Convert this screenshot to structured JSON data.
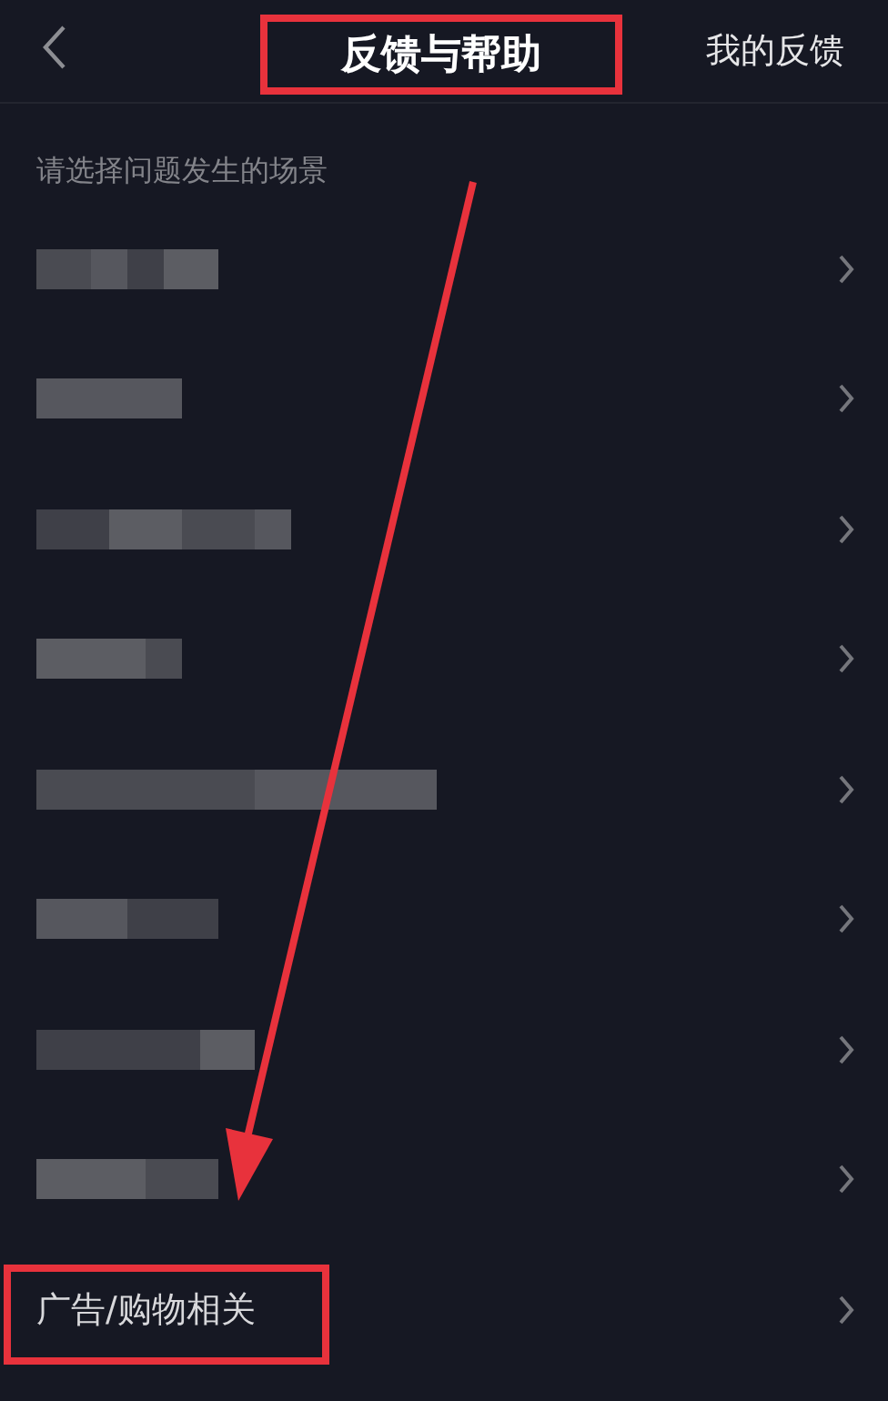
{
  "header": {
    "title": "反馈与帮助",
    "title_highlighted": true,
    "action": "我的反馈"
  },
  "prompt": "请选择问题发生的场景",
  "items": [
    {
      "kind": "redacted"
    },
    {
      "kind": "redacted"
    },
    {
      "kind": "redacted"
    },
    {
      "kind": "redacted"
    },
    {
      "kind": "redacted"
    },
    {
      "kind": "redacted"
    },
    {
      "kind": "redacted"
    },
    {
      "kind": "redacted"
    },
    {
      "kind": "text",
      "label": "广告/购物相关",
      "highlighted": true
    }
  ],
  "annotation": {
    "kind": "arrow"
  }
}
